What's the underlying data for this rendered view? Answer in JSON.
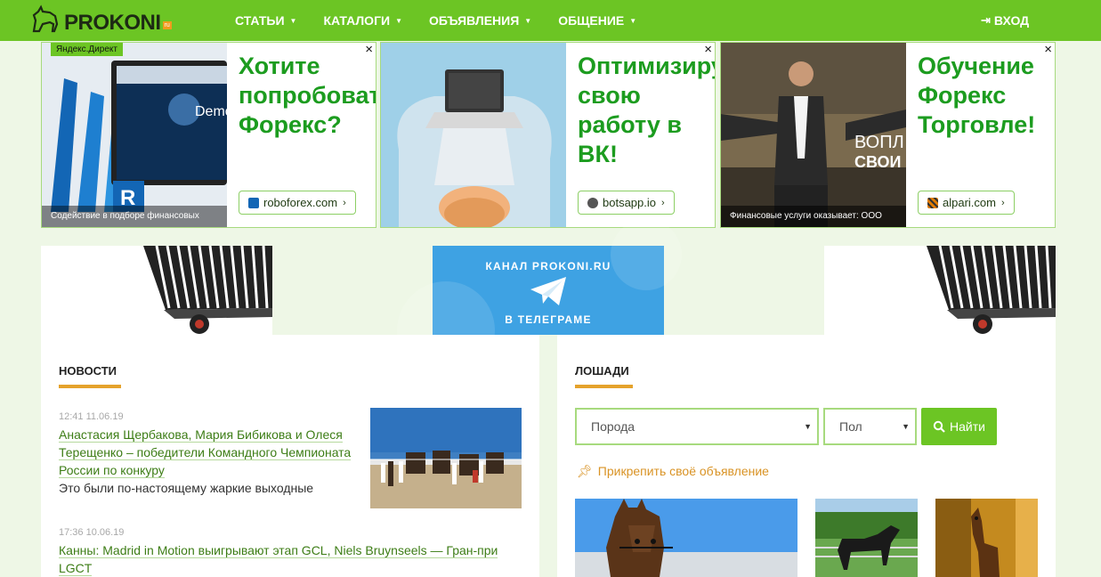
{
  "header": {
    "logo": "PROKONI",
    "logo_badge": "ru",
    "nav": [
      {
        "label": "СТАТЬИ"
      },
      {
        "label": "КАТАЛОГИ"
      },
      {
        "label": "ОБЪЯВЛЕНИЯ"
      },
      {
        "label": "ОБЩЕНИЕ"
      }
    ],
    "login": "ВХОД"
  },
  "ads": [
    {
      "badge": "Яндекс.Директ",
      "title": "Хотите попробовать Форекс?",
      "link": "roboforex.com",
      "caption": "Содействие в подборе финансовых",
      "img_text": "Demo",
      "close": "×"
    },
    {
      "title": "Оптимизируй свою работу в ВК!",
      "link": "botsapp.io",
      "close": "×"
    },
    {
      "title": "Обучение Форекс Торговле!",
      "link": "alpari.com",
      "caption": "Финансовые услуги оказывает: ООО",
      "img_text1": "ВОПЛ",
      "img_text2": "СВОИ",
      "close": "×"
    }
  ],
  "telegram": {
    "line1": "КАНАЛ PROKONI.RU",
    "line2": "В ТЕЛЕГРАМЕ"
  },
  "news": {
    "title": "НОВОСТИ",
    "items": [
      {
        "meta": "12:41 11.06.19",
        "title_lines": [
          "Анастасия Щербакова, Мария Бибикова и Олеся",
          "Терещенко – победители Командного Чемпионата",
          "России по конкуру"
        ],
        "desc": "Это были по-настоящему жаркие выходные"
      },
      {
        "meta": "17:36 10.06.19",
        "title_lines": [
          "Канны: Madrid in Motion выигрывают этап GCL, Niels Bruynseels — Гран-при",
          "LGCT"
        ]
      }
    ]
  },
  "horses": {
    "title": "ЛОШАДИ",
    "breed_select": "Порода",
    "sex_select": "Пол",
    "find_button": "Найти",
    "pin_link": "Прикрепить своё объявление"
  },
  "colors": {
    "brand": "#6cc524",
    "accent": "#e5a22b",
    "link": "#3d7d16",
    "ad_title": "#1c9c1f"
  }
}
